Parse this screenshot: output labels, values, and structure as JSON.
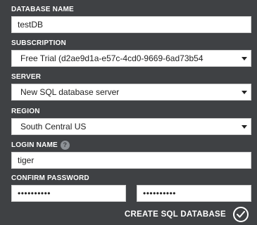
{
  "form": {
    "database_name": {
      "label": "DATABASE NAME",
      "value": "testDB"
    },
    "subscription": {
      "label": "SUBSCRIPTION",
      "selected": "Free Trial (d2ae9d1a-e57c-4cd0-9669-6ad73b54"
    },
    "server": {
      "label": "SERVER",
      "selected": "New SQL database server"
    },
    "region": {
      "label": "REGION",
      "selected": "South Central US"
    },
    "login_name": {
      "label": "LOGIN NAME",
      "help_symbol": "?",
      "value": "tiger"
    },
    "confirm_password": {
      "label": "CONFIRM PASSWORD",
      "password_value": "••••••••••",
      "confirm_value": "••••••••••"
    },
    "submit": {
      "label": "CREATE SQL DATABASE",
      "icon": "checkmark-icon"
    }
  },
  "colors": {
    "background": "#3f4144",
    "text": "#ffffff",
    "field_background": "#ffffff"
  }
}
